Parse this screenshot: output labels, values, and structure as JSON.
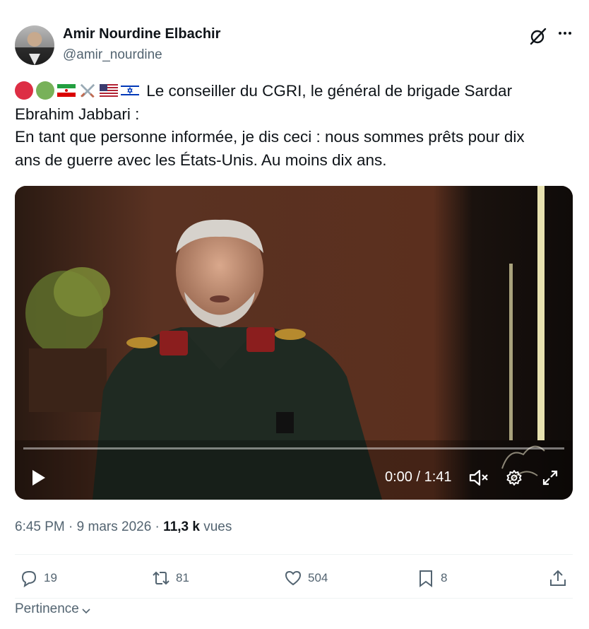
{
  "author": {
    "name": "Amir Nourdine Elbachir",
    "handle": "@amir_nourdine"
  },
  "tweet": {
    "emojis": [
      "red-circle",
      "green-circle",
      "iran-flag",
      "crossed-swords",
      "us-flag",
      "israel-flag"
    ],
    "text_line1": "Le conseiller du CGRI, le général de brigade Sardar",
    "text_line2": "Ebrahim Jabbari :",
    "text_line3": "En tant que personne informée, je dis ceci : nous sommes prêts pour dix",
    "text_line4": "ans de guerre avec les États-Unis. Au moins dix ans."
  },
  "video": {
    "time": "0:00 / 1:41",
    "progress": 0
  },
  "meta": {
    "time": "6:45 PM",
    "sep1": " · ",
    "date": "9 mars 2026",
    "sep2": " · ",
    "views": "11,3 k",
    "views_label": " vues"
  },
  "actions": {
    "replies": "19",
    "reposts": "81",
    "likes": "504",
    "bookmarks": "8"
  },
  "sort": {
    "label": "Pertinence"
  },
  "colors": {
    "text_primary": "#0f1419",
    "text_secondary": "#536471"
  }
}
